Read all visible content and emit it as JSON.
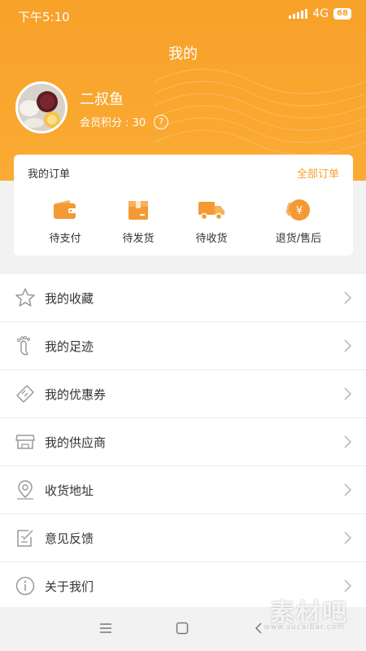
{
  "status_bar": {
    "time": "下午5:10",
    "network": "4G",
    "battery": "68"
  },
  "header": {
    "title": "我的"
  },
  "profile": {
    "name": "二叔鱼",
    "points_label": "会员积分 : 30",
    "help_symbol": "?"
  },
  "orders": {
    "title": "我的订单",
    "view_all": "全部订单",
    "items": [
      {
        "label": "待支付",
        "icon": "wallet-icon"
      },
      {
        "label": "待发货",
        "icon": "box-icon"
      },
      {
        "label": "待收货",
        "icon": "truck-icon"
      },
      {
        "label": "退货/售后",
        "icon": "refund-icon"
      }
    ]
  },
  "menu": [
    {
      "label": "我的收藏",
      "icon": "star-icon"
    },
    {
      "label": "我的足迹",
      "icon": "footprint-icon"
    },
    {
      "label": "我的优惠券",
      "icon": "coupon-icon"
    },
    {
      "label": "我的供应商",
      "icon": "store-icon"
    },
    {
      "label": "收货地址",
      "icon": "location-icon"
    },
    {
      "label": "意见反馈",
      "icon": "feedback-icon"
    },
    {
      "label": "关于我们",
      "icon": "info-icon"
    }
  ],
  "watermark": {
    "text": "素材吧",
    "sub": "www.sucaibar.com"
  },
  "colors": {
    "accent": "#f7a129",
    "icon_orange": "#f39a34",
    "background": "#f2f2f2"
  }
}
